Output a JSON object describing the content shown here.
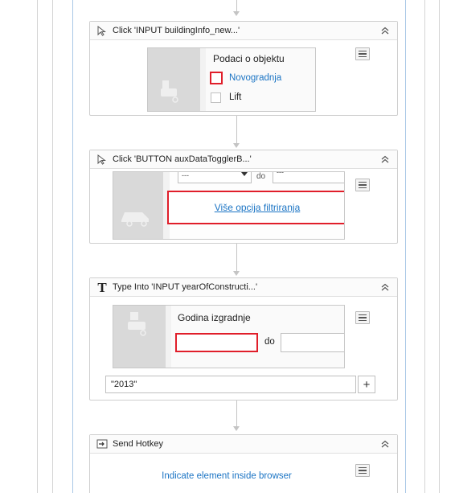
{
  "activities": [
    {
      "title": "Click 'INPUT  buildingInfo_new...'",
      "icon": "click-pointer-icon",
      "preview": {
        "section_title": "Podaci o objektu",
        "checkbox1_label": "Novogradnja",
        "checkbox2_label": "Lift"
      }
    },
    {
      "title": "Click 'BUTTON  auxDataTogglerB...'",
      "icon": "click-pointer-icon",
      "preview": {
        "select_value": "---",
        "range_label": "do",
        "select2_value": "---",
        "link_label": "Više opcija filtriranja"
      }
    },
    {
      "title": "Type Into 'INPUT  yearOfConstructi...'",
      "icon": "type-into-icon",
      "preview": {
        "field_label": "Godina izgradnje",
        "range_label": "do"
      },
      "text_value": "\"2013\"",
      "add_label": "+"
    },
    {
      "title": "Send Hotkey",
      "icon": "send-hotkey-icon",
      "indicate_label": "Indicate element inside browser"
    }
  ],
  "colors": {
    "accent_red": "#e01e2a",
    "link_blue": "#1b74c4"
  }
}
